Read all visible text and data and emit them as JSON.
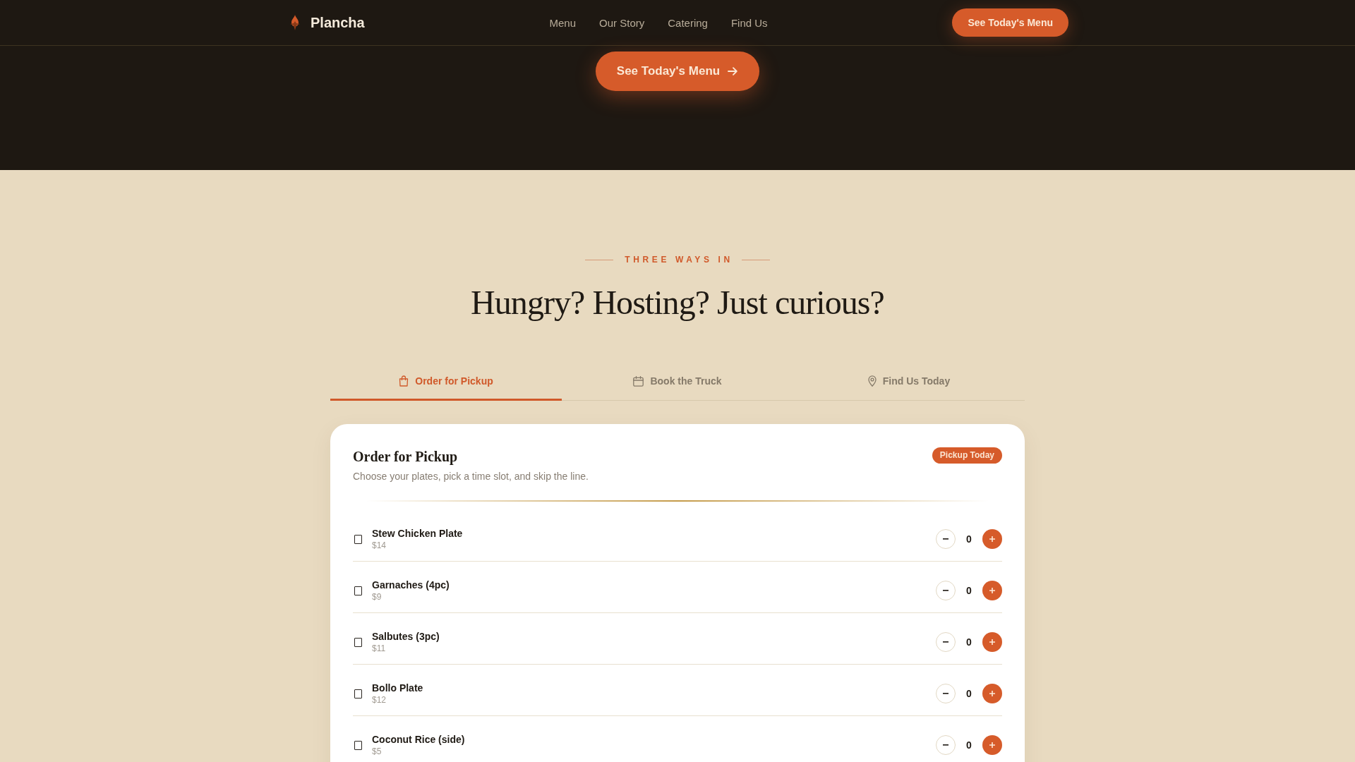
{
  "nav": {
    "brand": "Plancha",
    "links": [
      "Menu",
      "Our Story",
      "Catering",
      "Find Us"
    ],
    "cta": "See Today's Menu"
  },
  "hero": {
    "cta": "See Today's Menu"
  },
  "section": {
    "eyebrow": "THREE WAYS IN",
    "heading": "Hungry? Hosting? Just curious?"
  },
  "tabs": [
    {
      "label": "Order for Pickup",
      "kind": "bag",
      "selected": true
    },
    {
      "label": "Book the Truck",
      "kind": "calendar",
      "selected": false
    },
    {
      "label": "Find Us Today",
      "kind": "pin",
      "selected": false
    }
  ],
  "panel": {
    "title": "Order for Pickup",
    "subtitle": "Choose your plates, pick a time slot, and skip the line.",
    "badge": "Pickup Today",
    "items": [
      {
        "name": "Stew Chicken Plate",
        "price": "$14",
        "checked": false,
        "quantity": "0"
      },
      {
        "name": "Garnaches (4pc)",
        "price": "$9",
        "checked": false,
        "quantity": "0"
      },
      {
        "name": "Salbutes (3pc)",
        "price": "$11",
        "checked": false,
        "quantity": "0"
      },
      {
        "name": "Bollo Plate",
        "price": "$12",
        "checked": false,
        "quantity": "0"
      },
      {
        "name": "Coconut Rice (side)",
        "price": "$5",
        "checked": false,
        "quantity": "0"
      }
    ]
  }
}
